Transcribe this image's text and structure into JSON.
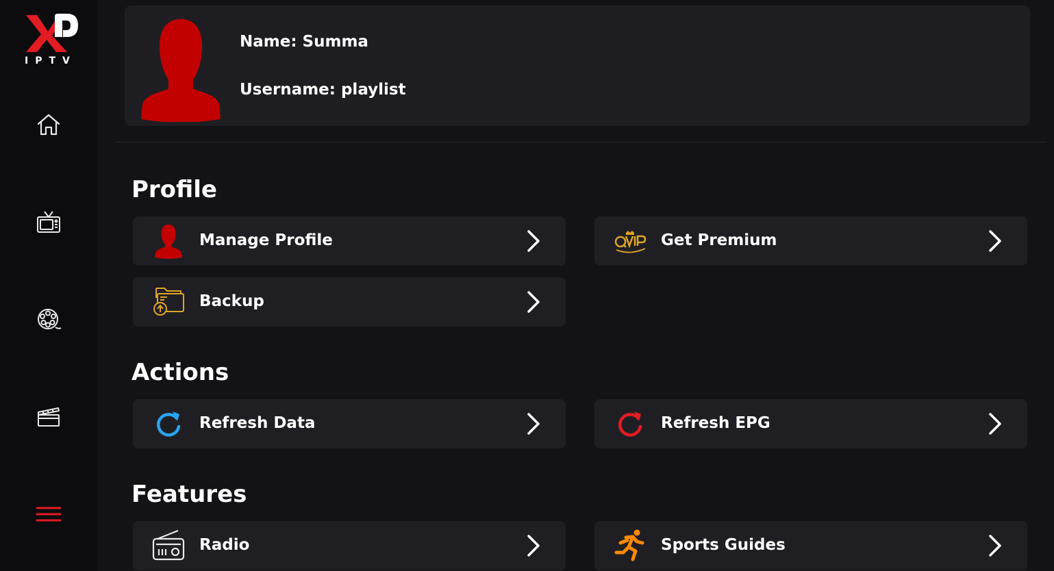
{
  "app": {
    "logo_text": "IPTV",
    "brand_color": "#e31b23"
  },
  "sidebar": {
    "items": [
      {
        "name": "home",
        "icon": "home-icon"
      },
      {
        "name": "live-tv",
        "icon": "tv-icon"
      },
      {
        "name": "movies",
        "icon": "film-reel-icon"
      },
      {
        "name": "series",
        "icon": "clapperboard-icon"
      },
      {
        "name": "menu",
        "icon": "hamburger-menu-icon",
        "active": true
      }
    ]
  },
  "profile": {
    "name": "Name: Summa",
    "username": "Username: playlist"
  },
  "sections": {
    "profile": {
      "title": "Profile",
      "manage_profile": "Manage Profile",
      "get_premium": "Get Premium",
      "backup": "Backup"
    },
    "actions": {
      "title": "Actions",
      "refresh_data": "Refresh Data",
      "refresh_epg": "Refresh EPG"
    },
    "features": {
      "title": "Features",
      "radio": "Radio",
      "sports_guides": "Sports Guides"
    }
  },
  "colors": {
    "accent_red": "#e31b23",
    "avatar_red": "#c30000",
    "refresh_blue": "#2aa3f0",
    "gold": "#e0a526",
    "orange": "#ff8a00",
    "card_bg": "#1f1f23"
  }
}
